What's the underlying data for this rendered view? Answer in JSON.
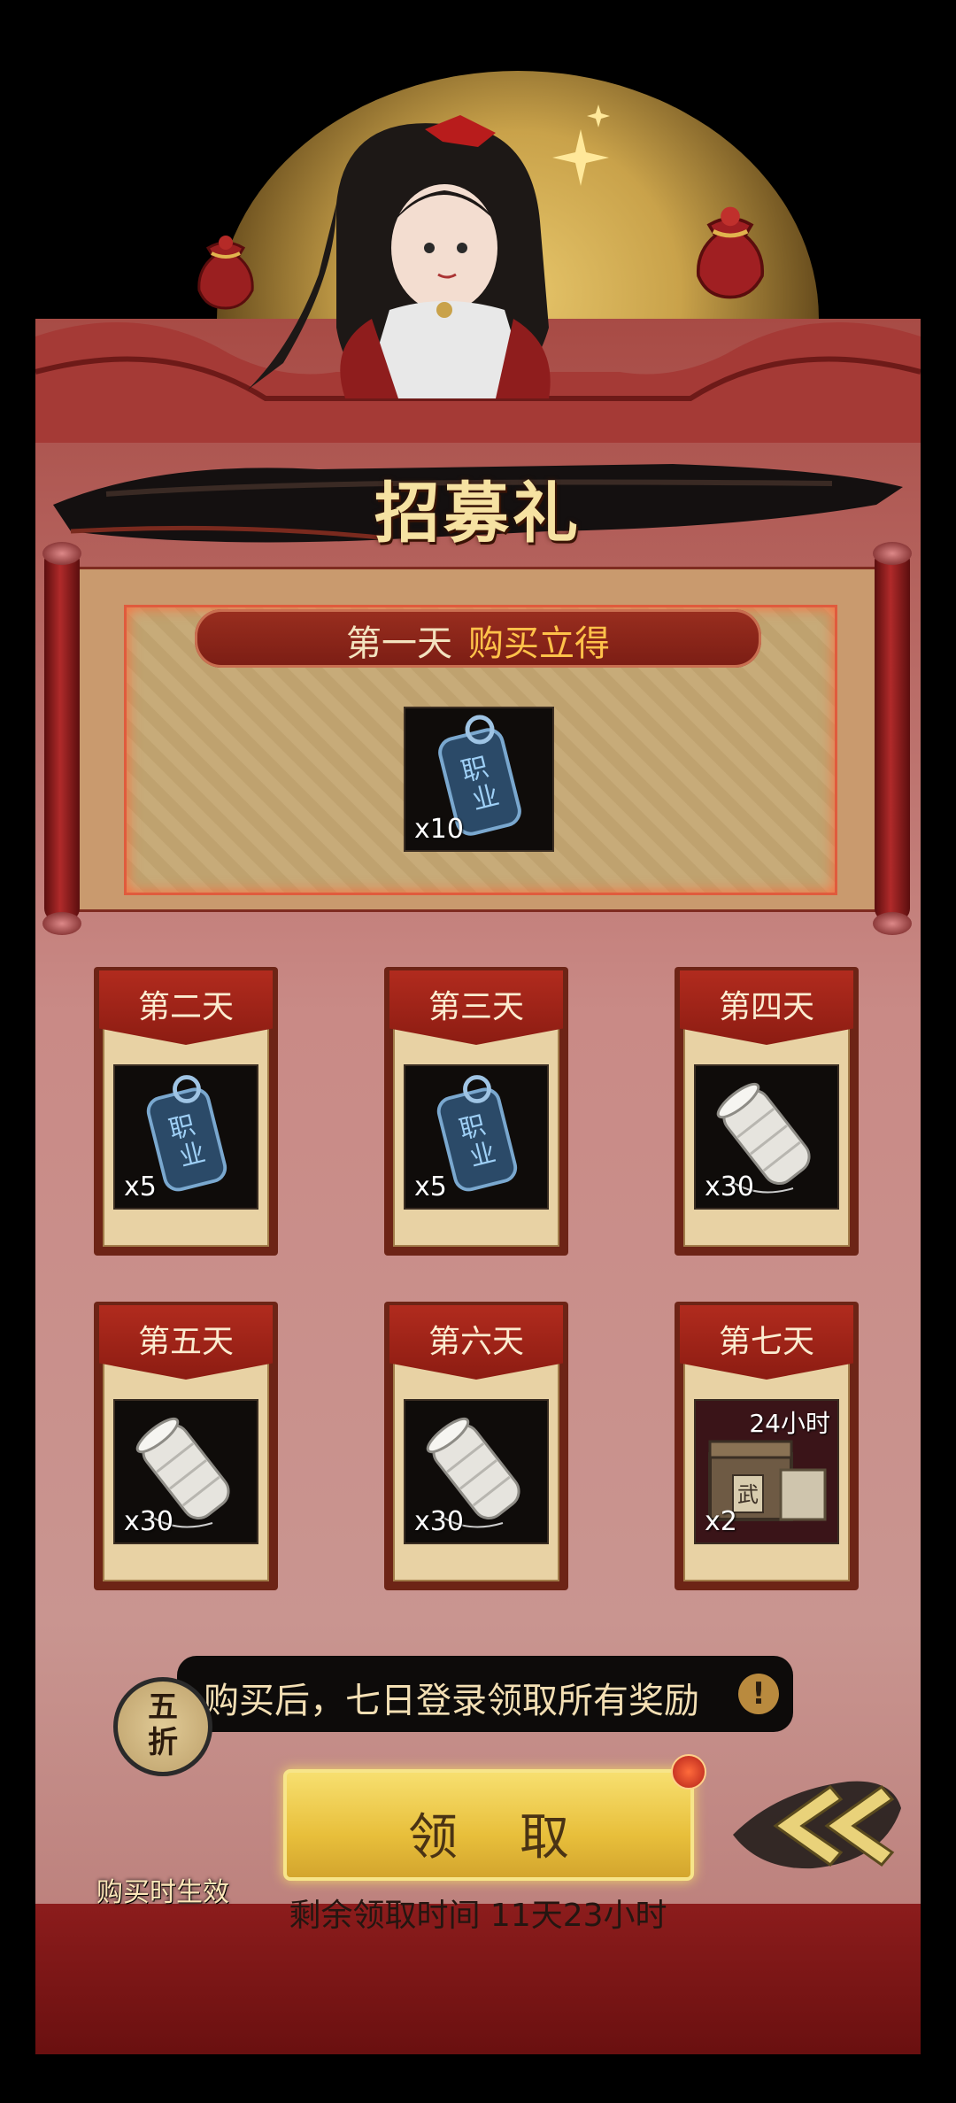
{
  "title": "招募礼",
  "day1": {
    "label": "第一天",
    "highlight": "购买立得",
    "item": {
      "icon": "profession-token-icon",
      "quantity": "x10"
    }
  },
  "days": [
    {
      "label": "第二天",
      "item": {
        "icon": "profession-token-icon",
        "quantity": "x5"
      }
    },
    {
      "label": "第三天",
      "item": {
        "icon": "profession-token-icon",
        "quantity": "x5"
      }
    },
    {
      "label": "第四天",
      "item": {
        "icon": "thread-spool-icon",
        "quantity": "x30"
      }
    },
    {
      "label": "第五天",
      "item": {
        "icon": "thread-spool-icon",
        "quantity": "x30"
      }
    },
    {
      "label": "第六天",
      "item": {
        "icon": "thread-spool-icon",
        "quantity": "x30"
      }
    },
    {
      "label": "第七天",
      "item": {
        "icon": "martial-chest-icon",
        "quantity": "x2",
        "badge": "24小时",
        "glyph": "武"
      }
    }
  ],
  "info_text": "购买后，七日登录领取所有奖励",
  "info_icon": "!",
  "claim_label": "领取",
  "remaining_time": "剩余领取时间  11天23小时",
  "discount": {
    "line1": "五",
    "line2": "折",
    "label": "购买时生效"
  },
  "colors": {
    "gold": "#f6e2a2",
    "accent": "#ffc24a",
    "panel": "#c99590",
    "banner": "#8c1c12"
  }
}
